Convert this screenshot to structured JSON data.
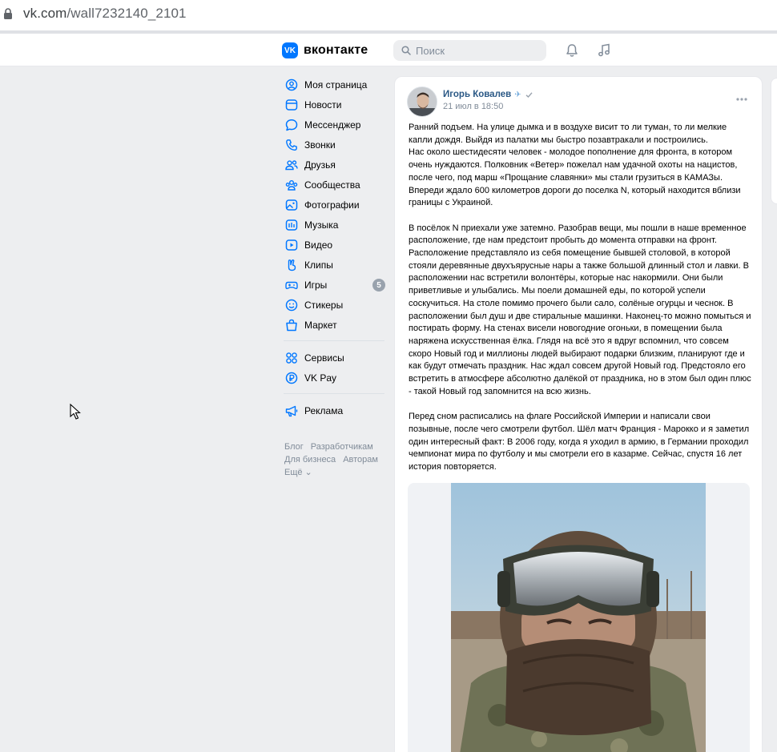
{
  "browser": {
    "url_host": "vk.com",
    "url_path": "/wall7232140_2101"
  },
  "header": {
    "logo_text": "вконтакте",
    "search_placeholder": "Поиск",
    "accent_color": "#0077ff"
  },
  "nav": {
    "main_items": [
      {
        "label": "Моя страница",
        "icon": "home-icon"
      },
      {
        "label": "Новости",
        "icon": "news-icon"
      },
      {
        "label": "Мессенджер",
        "icon": "message-icon"
      },
      {
        "label": "Звонки",
        "icon": "phone-icon"
      },
      {
        "label": "Друзья",
        "icon": "friends-icon"
      },
      {
        "label": "Сообщества",
        "icon": "communities-icon"
      },
      {
        "label": "Фотографии",
        "icon": "photo-icon"
      },
      {
        "label": "Музыка",
        "icon": "music-icon"
      },
      {
        "label": "Видео",
        "icon": "video-icon"
      },
      {
        "label": "Клипы",
        "icon": "clips-icon"
      },
      {
        "label": "Игры",
        "icon": "games-icon",
        "badge": "5"
      },
      {
        "label": "Стикеры",
        "icon": "stickers-icon"
      },
      {
        "label": "Маркет",
        "icon": "market-icon"
      }
    ],
    "service_items": [
      {
        "label": "Сервисы",
        "icon": "services-icon"
      },
      {
        "label": "VK Pay",
        "icon": "vkpay-icon"
      }
    ],
    "ads_items": [
      {
        "label": "Реклама",
        "icon": "megaphone-icon"
      }
    ],
    "footer": {
      "blog": "Блог",
      "developers": "Разработчикам",
      "business": "Для бизнеса",
      "authors": "Авторам",
      "more": "Ещё ⌄"
    }
  },
  "post": {
    "author": "Игорь Ковалев",
    "author_emoji": "✈",
    "date": "21 июл в 18:50",
    "paragraphs": [
      "Ранний подъем. На улице дымка и в воздухе висит то ли туман, то ли мелкие капли дождя. Выйдя из палатки мы быстро позавтракали и построились.\nНас около шестидесяти человек - молодое пополнение для фронта, в котором очень нуждаются. Полковник «Ветер» пожелал нам удачной охоты на нацистов, после чего, под марш «Прощание славянки» мы стали грузиться в КАМАЗы. Впереди ждало 600 километров дороги до поселка N, который находится вблизи границы с Украиной.",
      "В посёлок N приехали уже затемно. Разобрав вещи, мы пошли в наше временное расположение, где нам предстоит пробыть до момента отправки на фронт. Расположение представляло из себя помещение бывшей столовой, в которой стояли деревянные двухъярусные нары а также большой длинный стол и лавки. В расположении нас встретили волонтёры, которые нас накормили. Они были приветливые и улыбались. Мы поели домашней еды, по которой успели соскучиться. На столе помимо прочего были сало, солёные огурцы и чеснок. В расположении был душ и две стиральные машинки. Наконец-то можно помыться и постирать форму. На стенах висели новогодние огоньки, в помещении была наряжена искусственная ёлка. Глядя на всё это я вдруг вспомнил, что совсем скоро Новый год и миллионы людей выбирают подарки близким, планируют где и как будут отмечать праздник. Нас ждал совсем другой Новый год. Предстояло его встретить в атмосфере абсолютно далёкой от праздника, но в этом был один плюс - такой Новый год запомнится на всю жизнь.",
      "Перед сном расписались на флаге Российской Империи и написали свои позывные, после чего смотрели футбол. Шёл матч Франция - Марокко и я заметил один интересный факт: В 2006 году, когда я уходил в армию, в Германии проходил чемпионат мира по футболу и мы смотрели его в казарме. Сейчас, спустя 16 лет история повторяется."
    ]
  }
}
